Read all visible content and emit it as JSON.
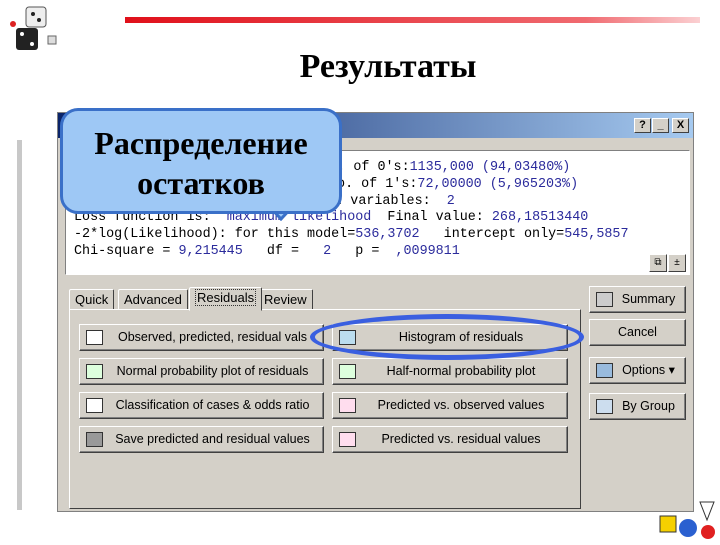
{
  "slide": {
    "title": "Результаты",
    "callout": [
      "Распределение",
      "остатков"
    ]
  },
  "window": {
    "help": "?",
    "minimize": "_",
    "close": "X"
  },
  "output": {
    "l1": [
      "git)  No. of 0's:",
      "1135,000 (94,03480%)"
    ],
    "l2": [
      "No. of 1's:",
      "72,00000 (5,965203%)"
    ],
    "l3": [
      "pendent variables:  ",
      "2"
    ],
    "l4": [
      "Loss function is:  ",
      "maximum likelihood",
      "  Final value: ",
      "268,18513440"
    ],
    "l5": [
      "-2*log(Likelihood): for this model=",
      "536,3702",
      "   intercept only=",
      "545,5857"
    ],
    "l6": [
      "Chi-square = ",
      "9,215445",
      "   df =   ",
      "2",
      "   p =  ",
      ",0099811"
    ]
  },
  "tabs": [
    "Quick",
    "Advanced",
    "Residuals",
    "Review"
  ],
  "active_tab": "Residuals",
  "buttons_left": [
    "Observed, predicted, residual vals",
    "Normal probability plot of residuals",
    "Classification of cases & odds ratio",
    "Save predicted and residual values"
  ],
  "buttons_right": [
    "Histogram of residuals",
    "Half-normal probability plot",
    "Predicted vs. observed values",
    "Predicted vs. residual values"
  ],
  "side_buttons": [
    "Summary",
    "Cancel",
    "Options ▾",
    "By Group"
  ],
  "colors": {
    "highlight": "#3a5fe0",
    "callout": "#9ec8f5",
    "values": "#2b2b9c"
  }
}
